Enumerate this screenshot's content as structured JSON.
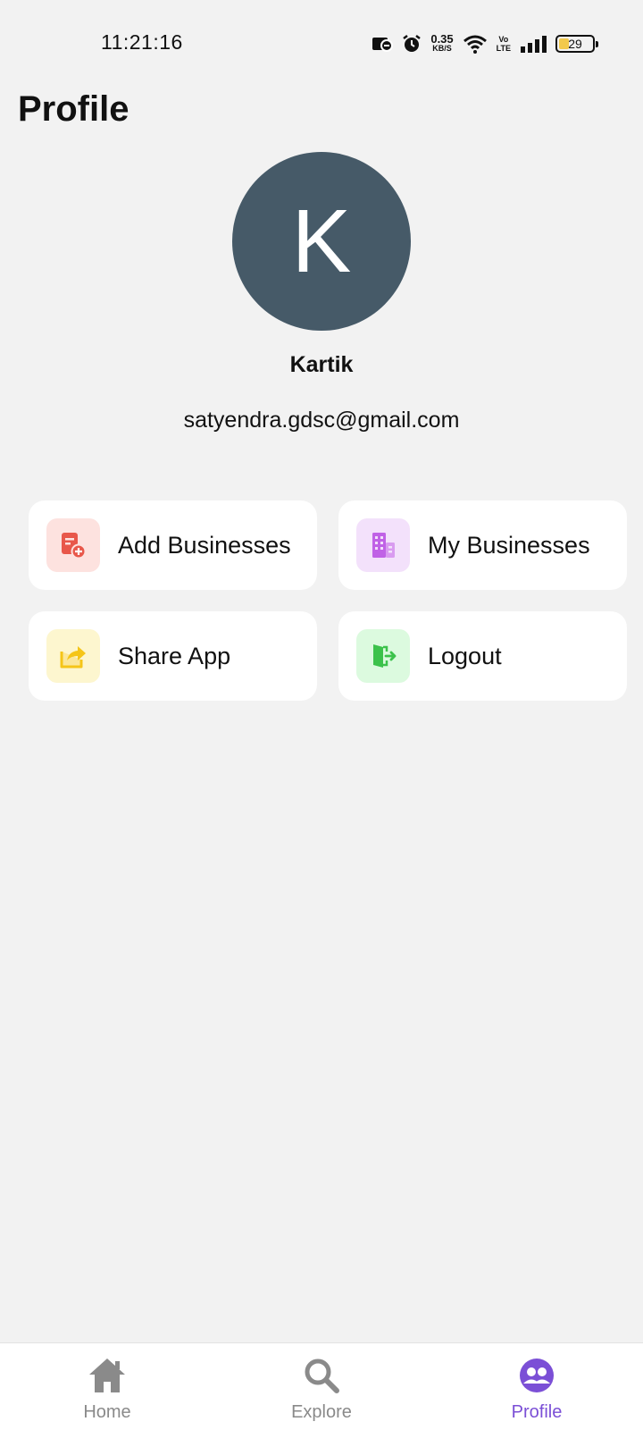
{
  "status_bar": {
    "time": "11:21:16",
    "net_speed_value": "0.35",
    "net_speed_unit": "KB/S",
    "volte_top": "Vo",
    "volte_bottom": "LTE",
    "battery": "29",
    "icons": [
      "notification-icon",
      "alarm-icon",
      "wifi-icon",
      "signal-icon",
      "battery-icon"
    ]
  },
  "header": {
    "title": "Profile"
  },
  "profile": {
    "avatar_letter": "K",
    "avatar_color": "#465a68",
    "name": "Kartik",
    "email": "satyendra.gdsc@gmail.com"
  },
  "actions": [
    {
      "label": "Add Businesses",
      "icon": "add-business-icon",
      "color": "#e8574a"
    },
    {
      "label": "My Businesses",
      "icon": "building-icon",
      "color": "#c062e6"
    },
    {
      "label": "Share App",
      "icon": "share-icon",
      "color": "#f5c518"
    },
    {
      "label": "Logout",
      "icon": "logout-icon",
      "color": "#3cc24b"
    }
  ],
  "bottom_nav": {
    "items": [
      {
        "label": "Home",
        "icon": "home-icon",
        "active": false
      },
      {
        "label": "Explore",
        "icon": "search-icon",
        "active": false
      },
      {
        "label": "Profile",
        "icon": "profile-icon",
        "active": true
      }
    ],
    "active_color": "#7b4fd6",
    "inactive_color": "#8a8a8a"
  }
}
